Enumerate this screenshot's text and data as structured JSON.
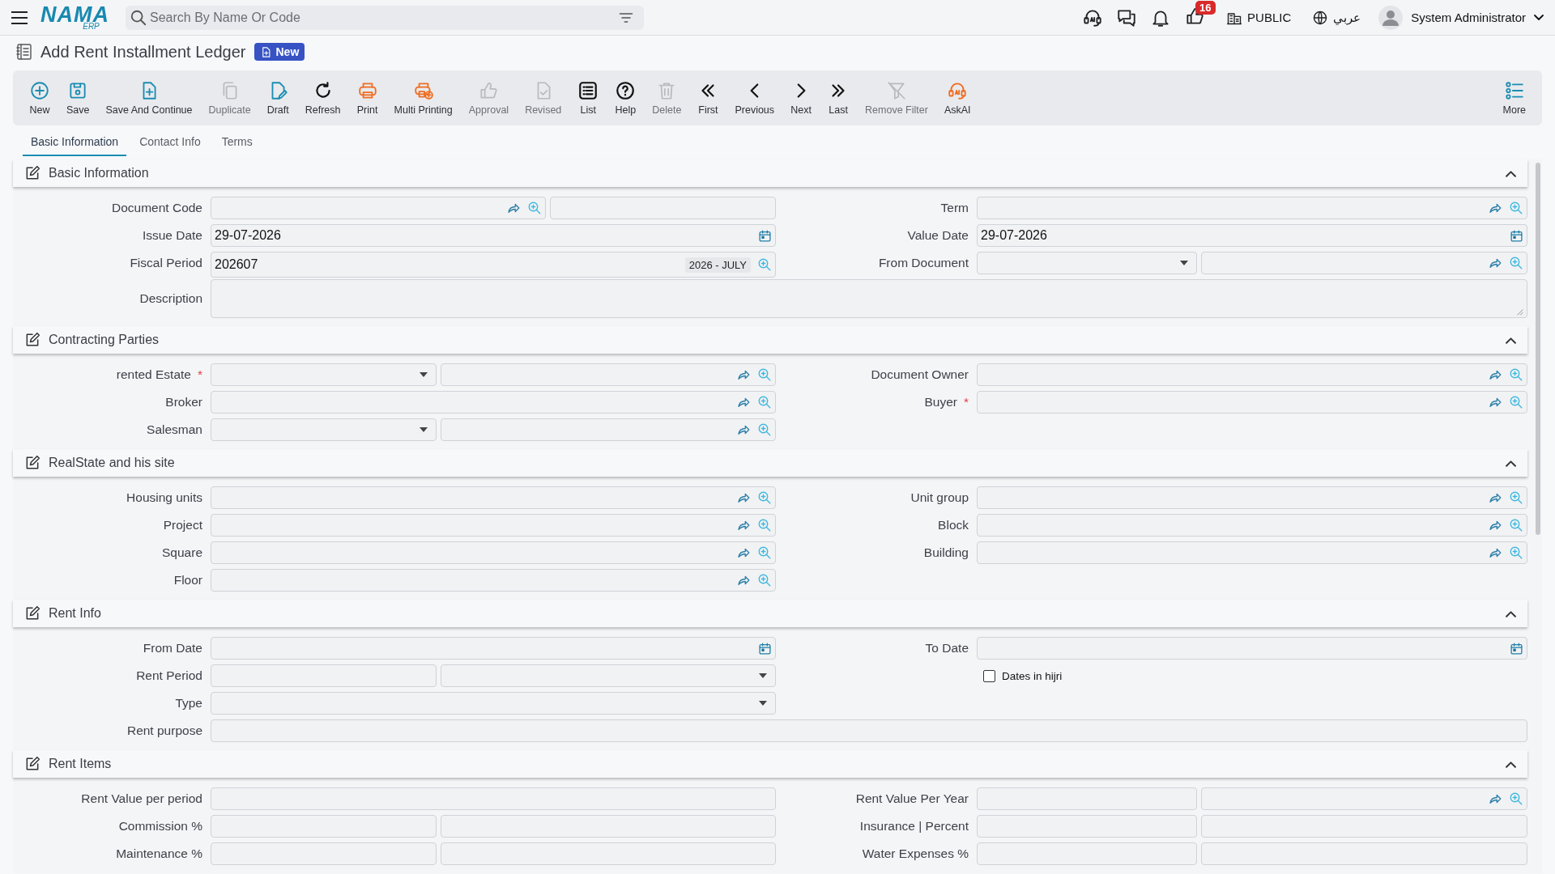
{
  "topbar": {
    "logo": "NAMA",
    "logo_sub": "ERP",
    "search_placeholder": "Search By Name Or Code",
    "notification_count": "16",
    "company": "PUBLIC",
    "language": "عربي",
    "user": "System Administrator"
  },
  "page": {
    "title": "Add Rent Installment Ledger",
    "status_badge": "New"
  },
  "toolbar": [
    {
      "label": "New",
      "kind": "plus-circle",
      "disabled": false
    },
    {
      "label": "Save",
      "kind": "save",
      "disabled": false
    },
    {
      "label": "Save And Continue",
      "kind": "doc-plus",
      "disabled": false
    },
    {
      "label": "Duplicate",
      "kind": "copy",
      "disabled": true
    },
    {
      "label": "Draft",
      "kind": "doc-pen",
      "disabled": false
    },
    {
      "label": "Refresh",
      "kind": "refresh",
      "disabled": false
    },
    {
      "label": "Print",
      "kind": "printer",
      "disabled": false
    },
    {
      "label": "Multi Printing",
      "kind": "printer-plus",
      "disabled": false
    },
    {
      "label": "Approval",
      "kind": "thumb",
      "disabled": true
    },
    {
      "label": "Revised",
      "kind": "doc-check",
      "disabled": true
    },
    {
      "label": "List",
      "kind": "list",
      "disabled": false
    },
    {
      "label": "Help",
      "kind": "help",
      "disabled": false
    },
    {
      "label": "Delete",
      "kind": "trash",
      "disabled": true
    },
    {
      "label": "First",
      "kind": "first",
      "disabled": false
    },
    {
      "label": "Previous",
      "kind": "prev",
      "disabled": false
    },
    {
      "label": "Next",
      "kind": "next",
      "disabled": false
    },
    {
      "label": "Last",
      "kind": "last",
      "disabled": false
    },
    {
      "label": "Remove Filter",
      "kind": "filter-off",
      "disabled": true
    },
    {
      "label": "AskAI",
      "kind": "ai",
      "disabled": false
    }
  ],
  "more_button": "More",
  "tabs": [
    {
      "label": "Basic Information",
      "selected": true
    },
    {
      "label": "Contact Info",
      "selected": false
    },
    {
      "label": "Terms",
      "selected": false
    }
  ],
  "sections": [
    {
      "title": "Basic Information",
      "expanded": true,
      "rows": [
        {
          "left": {
            "kind": "input",
            "label": "Document Code",
            "parts": [
              {
                "kind": "lookup"
              },
              {
                "kind": "text"
              }
            ]
          },
          "right": {
            "kind": "input",
            "label": "Term",
            "parts": [
              {
                "kind": "lookup"
              }
            ]
          }
        },
        {
          "left": {
            "kind": "input",
            "label": "Issue Date",
            "parts": [
              {
                "kind": "date",
                "value": "29-07-2026"
              }
            ]
          },
          "right": {
            "kind": "input",
            "label": "Value Date",
            "parts": [
              {
                "kind": "date",
                "value": "29-07-2026"
              }
            ]
          }
        },
        {
          "left": {
            "kind": "input",
            "label": "Fiscal Period",
            "parts": [
              {
                "kind": "search",
                "value": "202607",
                "tag": "2026 - JULY"
              }
            ]
          },
          "right": {
            "kind": "input",
            "label": "From Document",
            "parts": [
              {
                "kind": "select"
              },
              {
                "kind": "lookup"
              }
            ]
          }
        },
        {
          "full": {
            "kind": "input",
            "label": "Description",
            "parts": [
              {
                "kind": "textarea"
              }
            ]
          }
        }
      ]
    },
    {
      "title": "Contracting Parties",
      "expanded": true,
      "rows": [
        {
          "left": {
            "kind": "input",
            "label": "rented Estate",
            "required_mark": "*",
            "parts": [
              {
                "kind": "select"
              },
              {
                "kind": "lookup"
              }
            ]
          },
          "right": {
            "kind": "input",
            "label": "Document Owner",
            "parts": [
              {
                "kind": "lookup"
              }
            ]
          }
        },
        {
          "left": {
            "kind": "input",
            "label": "Broker",
            "parts": [
              {
                "kind": "lookup"
              }
            ]
          },
          "right": {
            "kind": "input",
            "label": "Buyer",
            "required_mark": "*",
            "parts": [
              {
                "kind": "lookup"
              }
            ]
          }
        },
        {
          "left": {
            "kind": "input",
            "label": "Salesman",
            "parts": [
              {
                "kind": "select"
              },
              {
                "kind": "lookup"
              }
            ]
          }
        }
      ]
    },
    {
      "title": "RealState and his site",
      "expanded": true,
      "rows": [
        {
          "left": {
            "kind": "input",
            "label": "Housing units",
            "parts": [
              {
                "kind": "lookup"
              }
            ]
          },
          "right": {
            "kind": "input",
            "label": "Unit group",
            "parts": [
              {
                "kind": "lookup"
              }
            ]
          }
        },
        {
          "left": {
            "kind": "input",
            "label": "Project",
            "parts": [
              {
                "kind": "lookup"
              }
            ]
          },
          "right": {
            "kind": "input",
            "label": "Block",
            "parts": [
              {
                "kind": "lookup"
              }
            ]
          }
        },
        {
          "left": {
            "kind": "input",
            "label": "Square",
            "parts": [
              {
                "kind": "lookup"
              }
            ]
          },
          "right": {
            "kind": "input",
            "label": "Building",
            "parts": [
              {
                "kind": "lookup"
              }
            ]
          }
        },
        {
          "left": {
            "kind": "input",
            "label": "Floor",
            "parts": [
              {
                "kind": "lookup"
              }
            ]
          }
        }
      ]
    },
    {
      "title": "Rent Info",
      "expanded": true,
      "rows": [
        {
          "left": {
            "kind": "input",
            "label": "From Date",
            "parts": [
              {
                "kind": "date"
              }
            ]
          },
          "right": {
            "kind": "input",
            "label": "To Date",
            "parts": [
              {
                "kind": "date"
              }
            ]
          }
        },
        {
          "left": {
            "kind": "input",
            "label": "Rent Period",
            "parts": [
              {
                "kind": "text"
              },
              {
                "kind": "select"
              }
            ]
          },
          "right": {
            "kind": "checkbox",
            "label": "Dates in hijri",
            "checked": false
          }
        },
        {
          "left": {
            "kind": "input",
            "label": "Type",
            "parts": [
              {
                "kind": "select"
              }
            ]
          }
        },
        {
          "full": {
            "kind": "input",
            "label": "Rent purpose",
            "parts": [
              {
                "kind": "text"
              }
            ]
          }
        }
      ]
    },
    {
      "title": "Rent Items",
      "expanded": true,
      "rows": [
        {
          "left": {
            "kind": "input",
            "label": "Rent Value per period",
            "parts": [
              {
                "kind": "text"
              }
            ]
          },
          "right": {
            "kind": "input",
            "label": "Rent Value Per Year",
            "parts": [
              {
                "kind": "text"
              },
              {
                "kind": "lookup"
              }
            ]
          }
        },
        {
          "left": {
            "kind": "input",
            "label": "Commission %",
            "parts": [
              {
                "kind": "text"
              },
              {
                "kind": "text"
              }
            ]
          },
          "right": {
            "kind": "input",
            "label": "Insurance | Percent",
            "parts": [
              {
                "kind": "text"
              },
              {
                "kind": "text"
              }
            ]
          }
        },
        {
          "left": {
            "kind": "input",
            "label": "Maintenance %",
            "parts": [
              {
                "kind": "text"
              },
              {
                "kind": "text"
              }
            ]
          },
          "right": {
            "kind": "input",
            "label": "Water Expenses %",
            "parts": [
              {
                "kind": "text"
              },
              {
                "kind": "text"
              }
            ]
          }
        }
      ]
    }
  ]
}
